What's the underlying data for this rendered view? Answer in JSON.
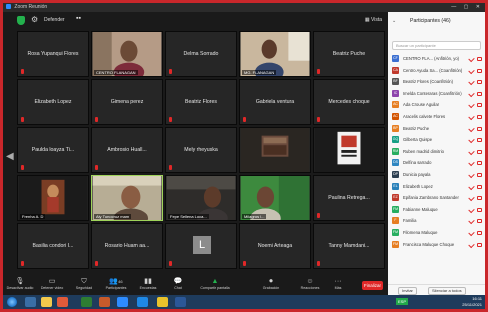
{
  "window": {
    "title": "Zoom Reunión"
  },
  "topbar": {
    "meeting_label": "Defender",
    "view_label": "Vista"
  },
  "tiles": [
    {
      "name": "Rosa Yupanqui Flores"
    },
    {
      "name": "",
      "overlay": "CENTRO FLANAGAN"
    },
    {
      "name": "Delma Sorrado"
    },
    {
      "name": "",
      "overlay": "MG. FLANAGAN"
    },
    {
      "name": "Beatriz Puche"
    },
    {
      "name": "Elizabeth Lopez"
    },
    {
      "name": "Gimena perez"
    },
    {
      "name": "Beatriz Flores"
    },
    {
      "name": "Gabriela ventura"
    },
    {
      "name": "Mercedes choque"
    },
    {
      "name": "Paulda loayza Ti..."
    },
    {
      "name": "Ambrosio Huall..."
    },
    {
      "name": "Mely rheyuska"
    },
    {
      "name": "",
      "overlay": ""
    },
    {
      "name": "",
      "overlay": ""
    },
    {
      "name": "",
      "overlay": "Frenha A. D"
    },
    {
      "name": "",
      "overlay": "Aly Tunocruz mam"
    },
    {
      "name": "",
      "overlay": "Fepe Sellena Loca..."
    },
    {
      "name": "",
      "overlay": "Milagros l..."
    },
    {
      "name": "Paulina Retrega..."
    },
    {
      "name": "Basilia condori I..."
    },
    {
      "name": "Rosario Huam aa..."
    },
    {
      "name": "",
      "initial": "L"
    },
    {
      "name": "Noemi Arteaga"
    },
    {
      "name": "Tanny Mamdani..."
    }
  ],
  "toolbar": {
    "buttons": [
      {
        "label": "Desactivar audio",
        "icon": "microphone-icon"
      },
      {
        "label": "Detener video",
        "icon": "video-camera-icon"
      },
      {
        "label": "Seguridad",
        "icon": "shield-icon"
      },
      {
        "label": "Participantes",
        "icon": "participants-icon",
        "count": "46"
      },
      {
        "label": "Encuestas",
        "icon": "poll-icon"
      },
      {
        "label": "Chat",
        "icon": "chat-icon"
      },
      {
        "label": "Compartir pantalla",
        "icon": "share-screen-icon"
      },
      {
        "label": "Grabación",
        "icon": "record-icon"
      },
      {
        "label": "Reacciones",
        "icon": "reactions-icon"
      },
      {
        "label": "Más",
        "icon": "more-icon"
      }
    ],
    "end_label": "Finalizar"
  },
  "panel": {
    "title": "Participantes (46)",
    "search_placeholder": "Buscar un participante",
    "participants": [
      {
        "name": "CENTRO FLA... (Anfitrión, yo)",
        "initial": "CF",
        "color": "#3b6fd1"
      },
      {
        "name": "Centro Ayuda Sa... (Coanfitrión)",
        "initial": "CA",
        "color": "#c0392b"
      },
      {
        "name": "Beatriz Flores (Coanfitrión)",
        "initial": "BF",
        "color": "#555555"
      },
      {
        "name": "Imelda Conteraras (Coanfitrión)",
        "initial": "IC",
        "color": "#8e44ad"
      },
      {
        "name": "Ada Crouse Aguilar",
        "initial": "AC",
        "color": "#e67e22"
      },
      {
        "name": "Aracelis calvete Flores",
        "initial": "AC",
        "color": "#d35400"
      },
      {
        "name": "Beatriz Puche",
        "initial": "BP",
        "color": "#e67e22"
      },
      {
        "name": "Gilberta Quispe",
        "initial": "GQ",
        "color": "#16a085"
      },
      {
        "name": "Ruben madrid dimitrio",
        "initial": "RM",
        "color": "#27ae60"
      },
      {
        "name": "Delfina sarrado",
        "initial": "DS",
        "color": "#2e86c1"
      },
      {
        "name": "Dunicia payala",
        "initial": "DP",
        "color": "#2c3e50"
      },
      {
        "name": "Elizabeth Lopez",
        "initial": "EL",
        "color": "#2980b9"
      },
      {
        "name": "Epifania Zambrano Santander",
        "initial": "EZ",
        "color": "#c0392b"
      },
      {
        "name": "Fabianne Maluque",
        "initial": "FM",
        "color": "#27ae60"
      },
      {
        "name": "Familia",
        "initial": "F",
        "color": "#e67e22"
      },
      {
        "name": "Filomena Maluque",
        "initial": "FM",
        "color": "#27ae60"
      },
      {
        "name": "Francisca Maluque Choque",
        "initial": "FM",
        "color": "#e67e22"
      }
    ],
    "invite_label": "Invitar",
    "mute_all_label": "Silenciar a todos"
  },
  "taskbar": {
    "language": "ESP",
    "time": "16:11",
    "date": "25/11/2021"
  },
  "colors": {
    "panel_bg": "#f7f7f7",
    "end_red": "#e02828",
    "frame_red": "#c9272b"
  }
}
